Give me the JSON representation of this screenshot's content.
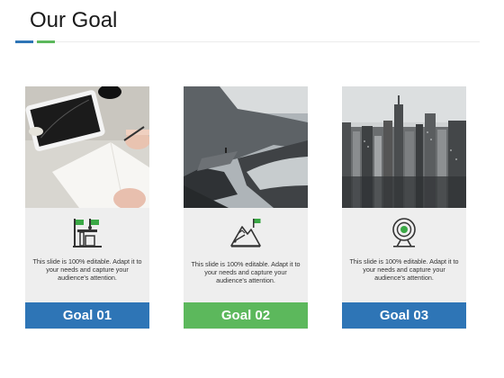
{
  "page": {
    "title": "Our Goal"
  },
  "colors": {
    "blue": "#2e75b6",
    "green": "#5cb85c",
    "card_bg": "#eeeeee"
  },
  "cards": [
    {
      "icon": "flag-podium-icon",
      "photo": "desk-tablet-photo",
      "text": "This slide is 100% editable. Adapt it to your needs and capture your audience's attention.",
      "button": "Goal 01",
      "button_color": "#2e75b6"
    },
    {
      "icon": "mountain-flag-icon",
      "photo": "mountain-lake-photo",
      "text": "This slide is 100% editable. Adapt it to your needs and capture your audience's attention.",
      "button": "Goal 02",
      "button_color": "#5cb85c"
    },
    {
      "icon": "target-stand-icon",
      "photo": "city-skyline-photo",
      "text": "This slide is 100% editable. Adapt it to your needs and capture your audience's attention.",
      "button": "Goal 03",
      "button_color": "#2e75b6"
    }
  ]
}
